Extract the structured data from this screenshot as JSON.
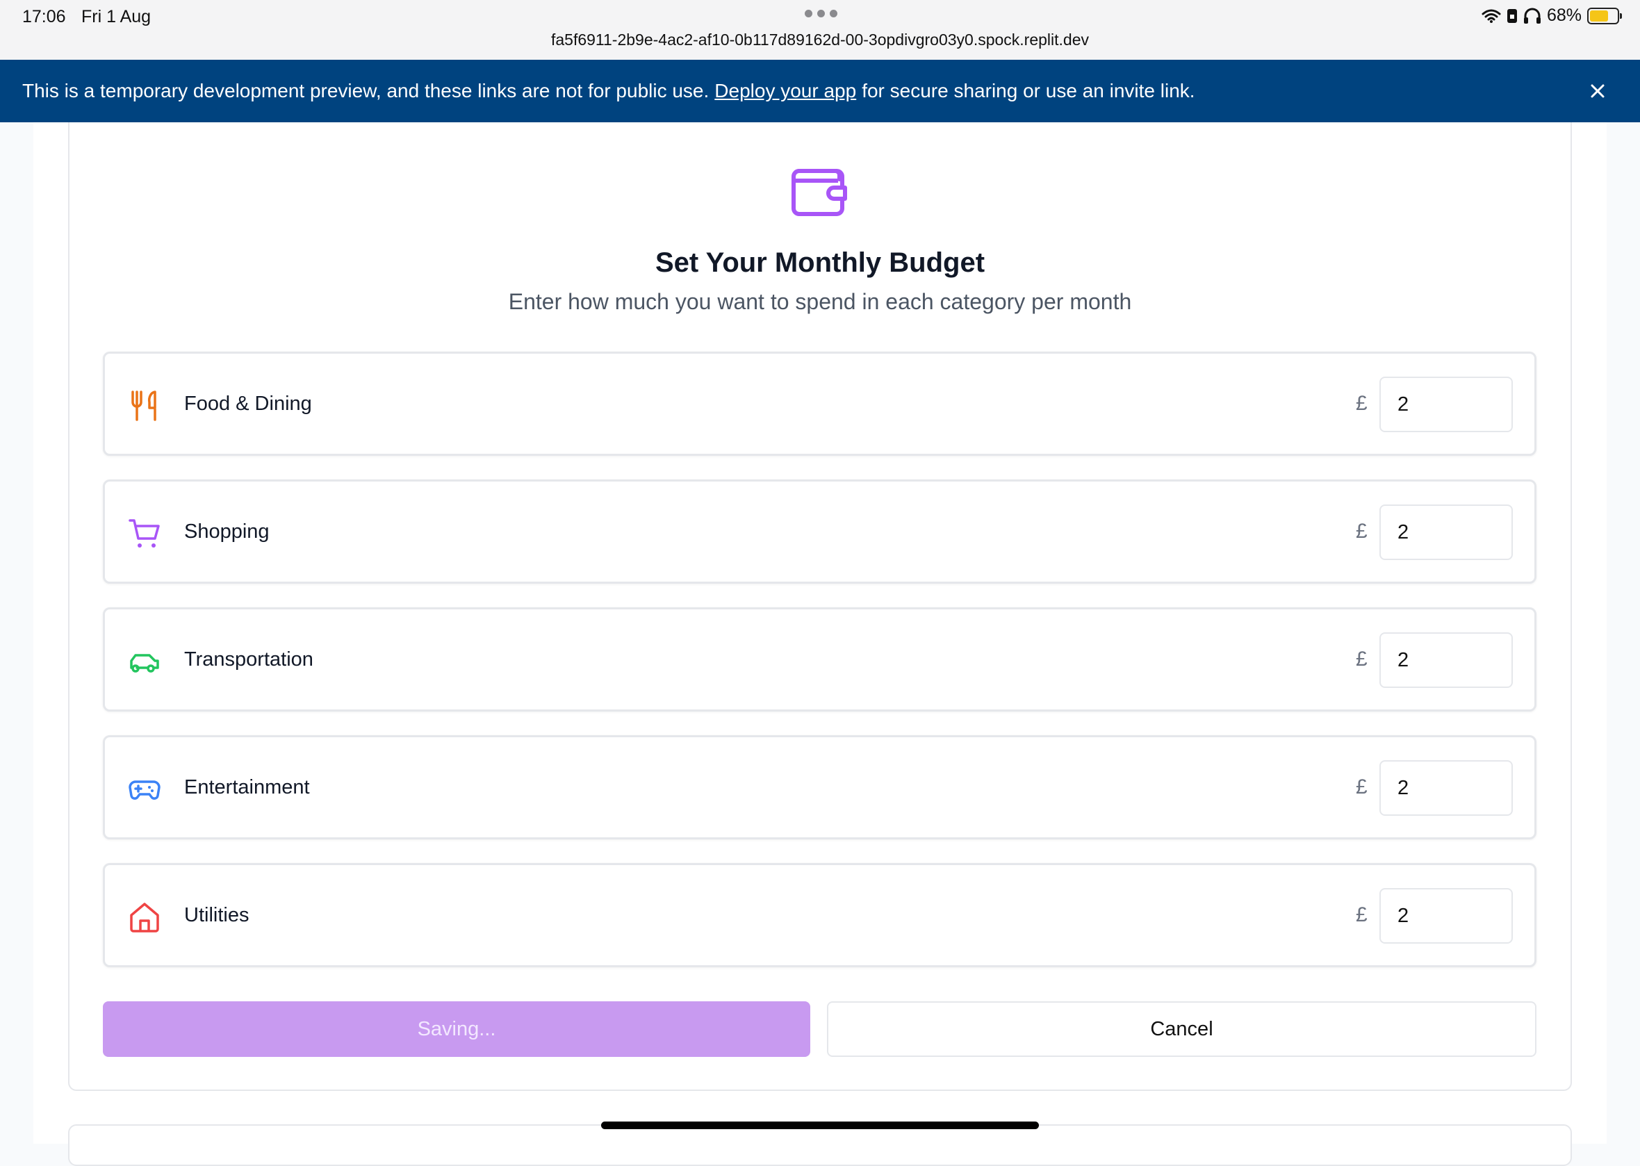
{
  "status_bar": {
    "time": "17:06",
    "date": "Fri 1 Aug",
    "url": "fa5f6911-2b9e-4ac2-af10-0b117d89162d-00-3opdivgro03y0.spock.replit.dev",
    "battery": "68%"
  },
  "banner": {
    "text_before": "This is a temporary development preview, and these links are not for public use.",
    "link": "Deploy your app",
    "text_after": "for secure sharing or use an invite link.",
    "bg_color": "#00437f"
  },
  "budget": {
    "title": "Set Your Monthly Budget",
    "subtitle": "Enter how much you want to spend in each category per month",
    "currency": "£",
    "categories": [
      {
        "label": "Food & Dining",
        "value": "2",
        "icon": "utensils-icon",
        "color": "#ea7317"
      },
      {
        "label": "Shopping",
        "value": "2",
        "icon": "shopping-cart-icon",
        "color": "#a855f7"
      },
      {
        "label": "Transportation",
        "value": "2",
        "icon": "car-icon",
        "color": "#22c55e"
      },
      {
        "label": "Entertainment",
        "value": "2",
        "icon": "gamepad-icon",
        "color": "#3b82f6"
      },
      {
        "label": "Utilities",
        "value": "2",
        "icon": "home-icon",
        "color": "#ef4444"
      }
    ]
  },
  "actions": {
    "save_label": "Saving...",
    "cancel_label": "Cancel"
  },
  "accent_color": "#a855f7"
}
